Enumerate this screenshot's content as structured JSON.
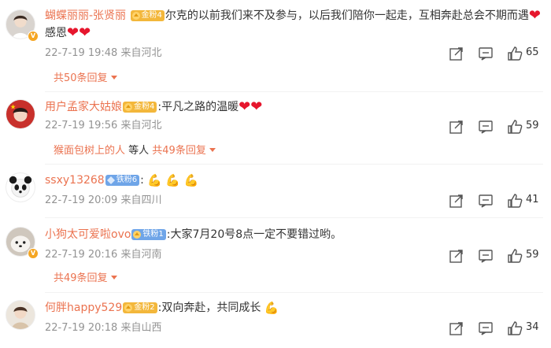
{
  "comments": [
    {
      "username": "蝴蝶丽丽-张贤丽",
      "badge": "金粉4",
      "text": "尔克的以前我们来不及参与，以后我们陪你一起走，互相奔赴总会不期而遇",
      "text2": "感恩",
      "time": "22-7-19 19:48",
      "location": "来自河北",
      "likes": "65",
      "replies_label": "共50条回复"
    },
    {
      "username": "用户孟家大姑娘",
      "badge": "金粉4",
      "text": ":平凡之路的温暖",
      "time": "22-7-19 19:56",
      "location": "来自河北",
      "likes": "59",
      "reply_user": "猴面包树上的人",
      "reply_text": " 等人 ",
      "replies_label": "共49条回复"
    },
    {
      "username": "ssxy13268",
      "badge": "铁粉6",
      "text": ":",
      "time": "22-7-19 20:09",
      "location": "来自四川",
      "likes": "41"
    },
    {
      "username": "小狗太可爱啦ovo",
      "badge": "铁粉1",
      "text": ":大家7月20号8点一定不要错过哟。",
      "time": "22-7-19 20:16",
      "location": "来自河南",
      "likes": "59",
      "replies_label": "共49条回复"
    },
    {
      "username": "何胖happy529",
      "badge": "金粉2",
      "text": ":双向奔赴，共同成长",
      "time": "22-7-19 20:18",
      "location": "来自山西",
      "likes": "34"
    }
  ],
  "colors": {
    "accent": "#eb7350",
    "meta": "#939393",
    "gold_badge": "#f3b73b",
    "iron_badge": "#6fa5e8",
    "heart": "#e6162d"
  },
  "icons": {
    "share": "share-icon",
    "comment": "comment-icon",
    "like": "thumbs-up-icon",
    "heart": "heart-emoji",
    "verified": "verified-v-icon"
  }
}
